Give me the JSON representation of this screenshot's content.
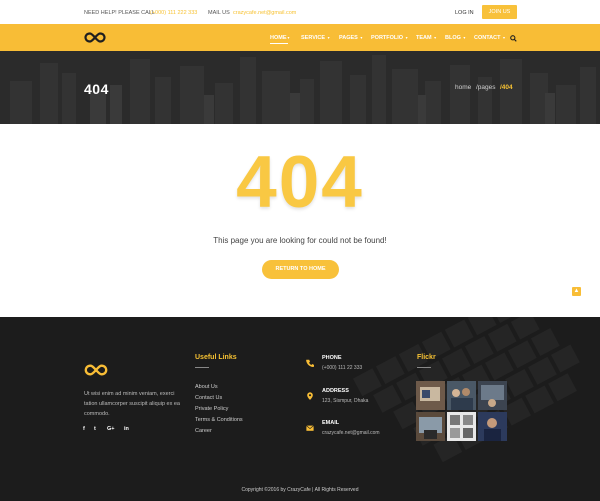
{
  "topbar": {
    "help_label": "NEED HELP! PLEASE CALL",
    "phone": "(+000) 111 222 333",
    "mail_label": "MAIL US",
    "email": "crazycafe.net@gmail.com",
    "login": "LOG IN",
    "join": "JOIN US"
  },
  "nav": {
    "items": [
      {
        "label": "HOME",
        "dropdown": true
      },
      {
        "label": "SERVICE",
        "dropdown": true
      },
      {
        "label": "PAGES",
        "dropdown": true
      },
      {
        "label": "PORTFOLIO",
        "dropdown": true
      },
      {
        "label": "TEAM",
        "dropdown": true
      },
      {
        "label": "BLOG",
        "dropdown": true
      },
      {
        "label": "CONTACT",
        "dropdown": true
      }
    ],
    "caret": "▾",
    "search_icon": "search-icon"
  },
  "page_header": {
    "title": "404",
    "breadcrumb": [
      "home",
      "/pages",
      "/404"
    ]
  },
  "main": {
    "code": "404",
    "message": "This page you are looking for could not be found!",
    "button": "RETURN TO HOME",
    "to_top": "▲"
  },
  "footer": {
    "description": "Ut wisi enim ad minim veniam, exerci tation ullamcorper suscipit aliquip ex ea commodo.",
    "social": [
      "f",
      "t",
      "G+",
      "in"
    ],
    "useful_links": {
      "title": "Useful Links",
      "items": [
        "About Us",
        "Contact Us",
        "Private Policy",
        "Terms & Conditions",
        "Career"
      ]
    },
    "contact": {
      "phone_label": "PHONE",
      "phone": "(+000) 111 22 333",
      "address_label": "ADDRESS",
      "address": "123, Sismpur, Dhaka",
      "email_label": "EMAIL",
      "email": "crazycafe.net@gmail.com"
    },
    "flickr_title": "Flickr",
    "copyright": "Copyright ©2016 by CrazyCafe   |   All Rights Reserved"
  },
  "colors": {
    "accent": "#f8bd36",
    "dark": "#1d1d1d",
    "header_bg": "#2a2a2a"
  }
}
